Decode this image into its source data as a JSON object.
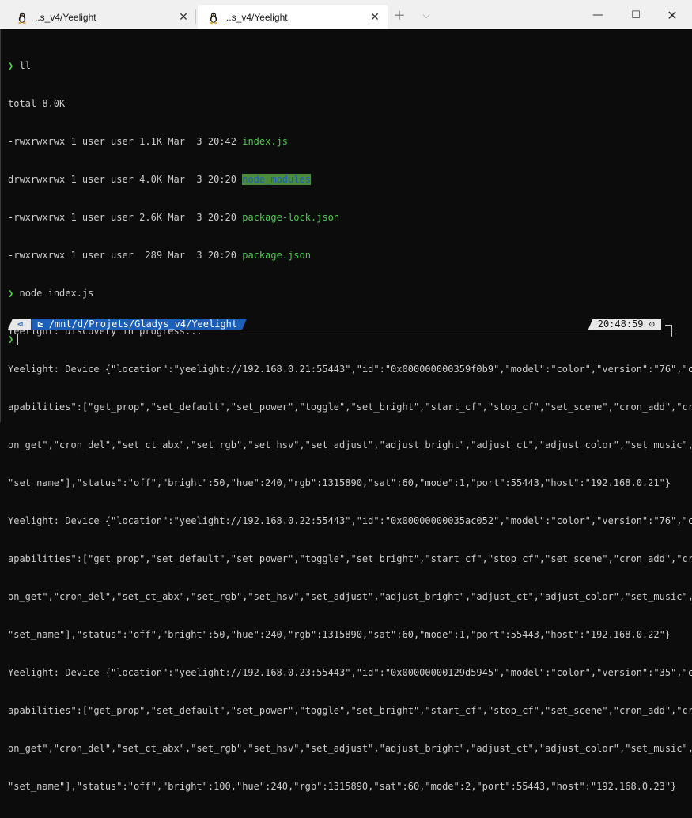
{
  "tabs": [
    {
      "title": "..s_v4/Yeelight",
      "icon": "linux-penguin-icon",
      "active": false
    },
    {
      "title": "..s_v4/Yeelight",
      "icon": "linux-penguin-icon",
      "active": true
    }
  ],
  "tab_close_glyph": "✕",
  "new_tab_glyph": "+",
  "dropdown_glyph": "⌵",
  "window_controls": {
    "minimize": "—",
    "maximize": "☐",
    "close": "✕"
  },
  "terminal": {
    "prompt_glyph": "❯",
    "cmd1": "ll",
    "total": "total 8.0K",
    "ls": [
      {
        "meta": "-rwxrwxrwx 1 user user 1.1K Mar  3 20:42 ",
        "name": "index.js",
        "style": "g"
      },
      {
        "meta": "drwxrwxrwx 1 user user 4.0K Mar  3 20:20 ",
        "name": "node_modules",
        "style": "hl"
      },
      {
        "meta": "-rwxrwxrwx 1 user user 2.6K Mar  3 20:20 ",
        "name": "package-lock.json",
        "style": "g"
      },
      {
        "meta": "-rwxrwxrwx 1 user user  289 Mar  3 20:20 ",
        "name": "package.json",
        "style": "g"
      }
    ],
    "cmd2": "node index.js",
    "output": [
      "Yeelight: Discovery in progress...",
      "Yeelight: Device {\"location\":\"yeelight://192.168.0.21:55443\",\"id\":\"0x000000000359f0b9\",\"model\":\"color\",\"version\":\"76\",\"c",
      "apabilities\":[\"get_prop\",\"set_default\",\"set_power\",\"toggle\",\"set_bright\",\"start_cf\",\"stop_cf\",\"set_scene\",\"cron_add\",\"cr",
      "on_get\",\"cron_del\",\"set_ct_abx\",\"set_rgb\",\"set_hsv\",\"set_adjust\",\"adjust_bright\",\"adjust_ct\",\"adjust_color\",\"set_music\",",
      "\"set_name\"],\"status\":\"off\",\"bright\":50,\"hue\":240,\"rgb\":1315890,\"sat\":60,\"mode\":1,\"port\":55443,\"host\":\"192.168.0.21\"}",
      "Yeelight: Device {\"location\":\"yeelight://192.168.0.22:55443\",\"id\":\"0x00000000035ac052\",\"model\":\"color\",\"version\":\"76\",\"c",
      "apabilities\":[\"get_prop\",\"set_default\",\"set_power\",\"toggle\",\"set_bright\",\"start_cf\",\"stop_cf\",\"set_scene\",\"cron_add\",\"cr",
      "on_get\",\"cron_del\",\"set_ct_abx\",\"set_rgb\",\"set_hsv\",\"set_adjust\",\"adjust_bright\",\"adjust_ct\",\"adjust_color\",\"set_music\",",
      "\"set_name\"],\"status\":\"off\",\"bright\":50,\"hue\":240,\"rgb\":1315890,\"sat\":60,\"mode\":1,\"port\":55443,\"host\":\"192.168.0.22\"}",
      "Yeelight: Device {\"location\":\"yeelight://192.168.0.23:55443\",\"id\":\"0x00000000129d5945\",\"model\":\"color\",\"version\":\"35\",\"c",
      "apabilities\":[\"get_prop\",\"set_default\",\"set_power\",\"toggle\",\"set_bright\",\"start_cf\",\"stop_cf\",\"set_scene\",\"cron_add\",\"cr",
      "on_get\",\"cron_del\",\"set_ct_abx\",\"set_rgb\",\"set_hsv\",\"set_adjust\",\"adjust_bright\",\"adjust_ct\",\"adjust_color\",\"set_music\",",
      "\"set_name\"],\"status\":\"off\",\"bright\":100,\"hue\":240,\"rgb\":1315890,\"sat\":60,\"mode\":2,\"port\":55443,\"host\":\"192.168.0.23\"}"
    ]
  },
  "statusbar": {
    "os_glyph": "⊲",
    "folder_glyph": "⊵",
    "path": "/mnt/d/Projets/Gladys_v4/Yeelight",
    "time": "20:48:59",
    "clock_glyph": "⊙"
  },
  "colors": {
    "background": "#0c0c0c",
    "text": "#cccccc",
    "green": "#4ec94e",
    "path_blue": "#1d5fb8",
    "highlight_bg": "#4a8c3a"
  }
}
